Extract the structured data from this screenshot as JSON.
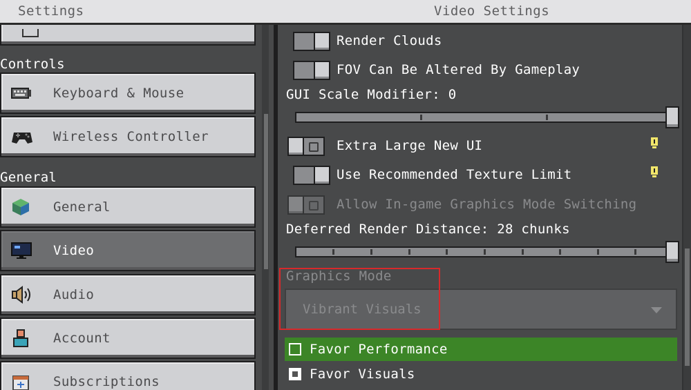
{
  "header": {
    "left_title": "Settings",
    "center_title": "Video Settings"
  },
  "sidebar": {
    "sections": [
      {
        "title": "Controls"
      },
      {
        "title": "General"
      }
    ],
    "items": [
      {
        "label": "Keyboard & Mouse",
        "icon": "keyboard-icon"
      },
      {
        "label": "Wireless Controller",
        "icon": "gamepad-icon"
      },
      {
        "label": "General",
        "icon": "cube-icon"
      },
      {
        "label": "Video",
        "icon": "monitor-icon",
        "selected": true
      },
      {
        "label": "Audio",
        "icon": "speaker-icon"
      },
      {
        "label": "Account",
        "icon": "person-icon"
      },
      {
        "label": "Subscriptions",
        "icon": "calendar-plus-icon"
      }
    ]
  },
  "settings": {
    "render_clouds": {
      "label": "Render Clouds",
      "state": "on"
    },
    "fov": {
      "label": "FOV Can Be Altered By Gameplay",
      "state": "on"
    },
    "gui_scale": {
      "label": "GUI Scale Modifier: 0",
      "value": 1.0
    },
    "extra_large_ui": {
      "label": "Extra Large New UI",
      "state": "off"
    },
    "texture_limit": {
      "label": "Use Recommended Texture Limit",
      "state": "on"
    },
    "graphics_switching": {
      "label": "Allow In-game Graphics Mode Switching",
      "state": "off",
      "disabled": true
    },
    "render_distance": {
      "label": "Deferred Render Distance: 28 chunks",
      "value": 1.0
    },
    "graphics_mode": {
      "label": "Graphics Mode",
      "value": "Vibrant Visuals",
      "options": [
        {
          "label": "Favor Performance",
          "selected": true
        },
        {
          "label": "Favor Visuals",
          "selected": false
        }
      ]
    }
  },
  "colors": {
    "accent_green": "#3c8527",
    "highlight_red": "#d8292b",
    "info_yellow": "#f2e66b"
  }
}
